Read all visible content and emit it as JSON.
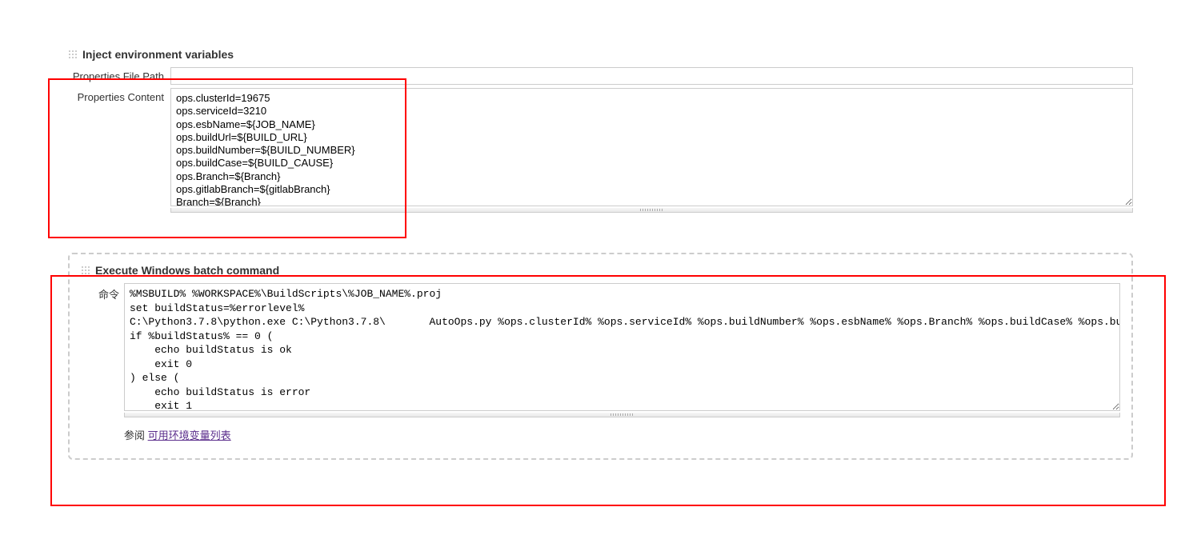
{
  "inject": {
    "title": "Inject environment variables",
    "filePathLabel": "Properties File Path",
    "filePathValue": "",
    "contentLabel": "Properties Content",
    "contentValue": "ops.clusterId=19675\nops.serviceId=3210\nops.esbName=${JOB_NAME}\nops.buildUrl=${BUILD_URL}\nops.buildNumber=${BUILD_NUMBER}\nops.buildCase=${BUILD_CAUSE}\nops.Branch=${Branch}\nops.gitlabBranch=${gitlabBranch}\nBranch=${Branch}"
  },
  "batch": {
    "title": "Execute Windows batch command",
    "cmdLabel": "命令",
    "cmdValue": "%MSBUILD% %WORKSPACE%\\BuildScripts\\%JOB_NAME%.proj\nset buildStatus=%errorlevel%\nC:\\Python3.7.8\\python.exe C:\\Python3.7.8\\       AutoOps.py %ops.clusterId% %ops.serviceId% %ops.buildNumber% %ops.esbName% %ops.Branch% %ops.buildCase% %ops.buildUrl% %buildStatus%\nif %buildStatus% == 0 (\n    echo buildStatus is ok\n    exit 0\n) else (\n    echo buildStatus is error\n    exit 1\n)",
    "hintPrefix": "参阅 ",
    "hintLink": "可用环境变量列表"
  }
}
